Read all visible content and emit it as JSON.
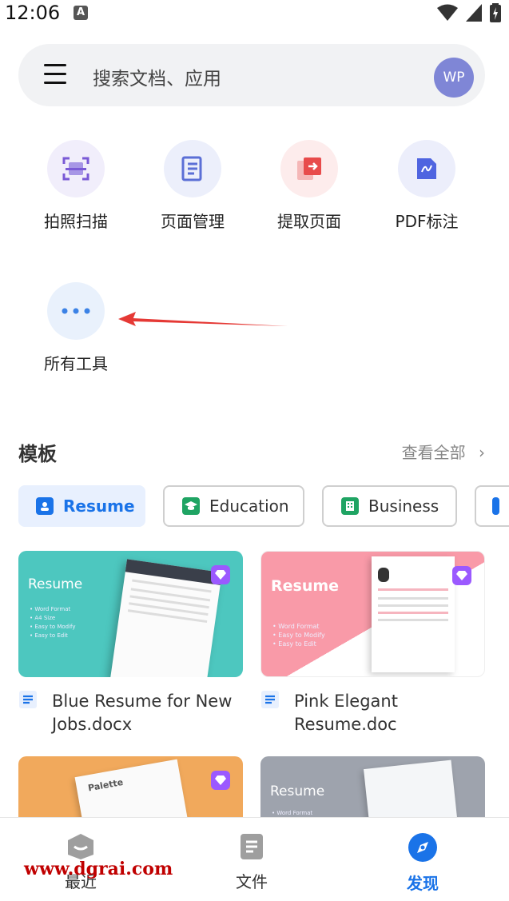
{
  "status_bar": {
    "time": "12:06"
  },
  "search": {
    "placeholder": "搜索文档、应用",
    "avatar": "WP"
  },
  "tools": [
    {
      "label": "拍照扫描",
      "icon": "scan-icon"
    },
    {
      "label": "页面管理",
      "icon": "page-manage-icon"
    },
    {
      "label": "提取页面",
      "icon": "extract-page-icon"
    },
    {
      "label": "PDF标注",
      "icon": "pdf-annotate-icon"
    },
    {
      "label": "所有工具",
      "icon": "more-dots-icon"
    }
  ],
  "templates": {
    "title": "模板",
    "see_all": "查看全部",
    "chips": [
      "Resume",
      "Education",
      "Business"
    ],
    "cards": [
      {
        "name": "Blue Resume for New Jobs.docx",
        "thumb_title": "Resume",
        "bullets": [
          "• Word Format",
          "• A4 Size",
          "• Easy to Modify",
          "• Easy to Edit"
        ]
      },
      {
        "name": "Pink Elegant Resume.doc",
        "thumb_title": "Resume",
        "bullets": [
          "• Word Format",
          "• Easy to Modify",
          "• Easy to Edit"
        ]
      },
      {
        "thumb_title": "Palette"
      },
      {
        "thumb_title": "Resume",
        "bullets": [
          "• Word Format"
        ]
      }
    ]
  },
  "nav": {
    "recent": "最近",
    "files": "文件",
    "discover": "发现"
  },
  "watermark": "www.dgrai.com",
  "colors": {
    "accent": "#1a73e8",
    "resume_teal": "#4dc7bf",
    "resume_pink": "#f99aa8",
    "annotation": "#e53935"
  }
}
